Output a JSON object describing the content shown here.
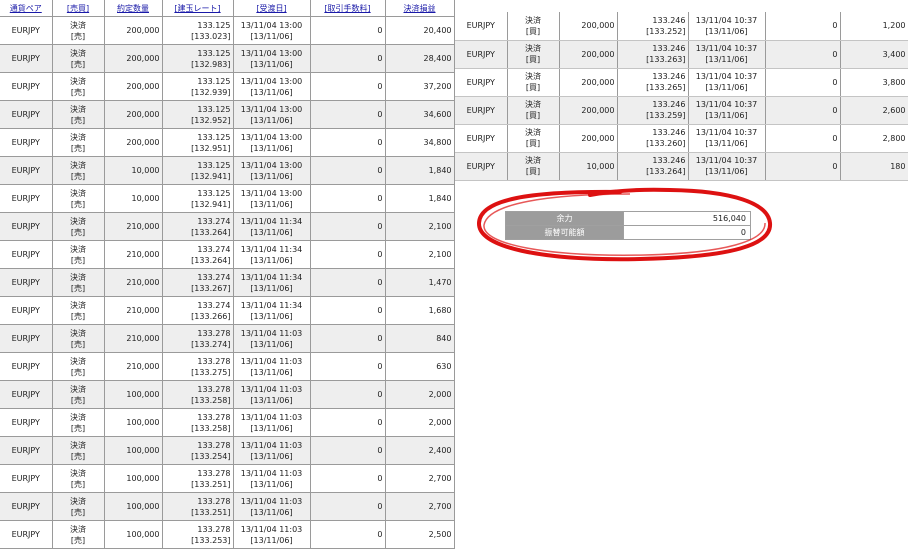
{
  "left_headers": [
    "通貨ペア",
    "[売買]",
    "約定数量",
    "[建玉レート]",
    "[受渡日]",
    "[取引手数料]",
    "決済損益"
  ],
  "left_rows": [
    {
      "pair": "EURJPY",
      "type": "決済",
      "side": "[売]",
      "qty": "200,000",
      "rate": "133.125",
      "open_rate": "[133.023]",
      "datetime": "13/11/04 13:00",
      "delivery": "[13/11/06]",
      "fee": "0",
      "pl": "20,400"
    },
    {
      "pair": "EURJPY",
      "type": "決済",
      "side": "[売]",
      "qty": "200,000",
      "rate": "133.125",
      "open_rate": "[132.983]",
      "datetime": "13/11/04 13:00",
      "delivery": "[13/11/06]",
      "fee": "0",
      "pl": "28,400"
    },
    {
      "pair": "EURJPY",
      "type": "決済",
      "side": "[売]",
      "qty": "200,000",
      "rate": "133.125",
      "open_rate": "[132.939]",
      "datetime": "13/11/04 13:00",
      "delivery": "[13/11/06]",
      "fee": "0",
      "pl": "37,200"
    },
    {
      "pair": "EURJPY",
      "type": "決済",
      "side": "[売]",
      "qty": "200,000",
      "rate": "133.125",
      "open_rate": "[132.952]",
      "datetime": "13/11/04 13:00",
      "delivery": "[13/11/06]",
      "fee": "0",
      "pl": "34,600"
    },
    {
      "pair": "EURJPY",
      "type": "決済",
      "side": "[売]",
      "qty": "200,000",
      "rate": "133.125",
      "open_rate": "[132.951]",
      "datetime": "13/11/04 13:00",
      "delivery": "[13/11/06]",
      "fee": "0",
      "pl": "34,800"
    },
    {
      "pair": "EURJPY",
      "type": "決済",
      "side": "[売]",
      "qty": "10,000",
      "rate": "133.125",
      "open_rate": "[132.941]",
      "datetime": "13/11/04 13:00",
      "delivery": "[13/11/06]",
      "fee": "0",
      "pl": "1,840"
    },
    {
      "pair": "EURJPY",
      "type": "決済",
      "side": "[売]",
      "qty": "10,000",
      "rate": "133.125",
      "open_rate": "[132.941]",
      "datetime": "13/11/04 13:00",
      "delivery": "[13/11/06]",
      "fee": "0",
      "pl": "1,840"
    },
    {
      "pair": "EURJPY",
      "type": "決済",
      "side": "[売]",
      "qty": "210,000",
      "rate": "133.274",
      "open_rate": "[133.264]",
      "datetime": "13/11/04 11:34",
      "delivery": "[13/11/06]",
      "fee": "0",
      "pl": "2,100"
    },
    {
      "pair": "EURJPY",
      "type": "決済",
      "side": "[売]",
      "qty": "210,000",
      "rate": "133.274",
      "open_rate": "[133.264]",
      "datetime": "13/11/04 11:34",
      "delivery": "[13/11/06]",
      "fee": "0",
      "pl": "2,100"
    },
    {
      "pair": "EURJPY",
      "type": "決済",
      "side": "[売]",
      "qty": "210,000",
      "rate": "133.274",
      "open_rate": "[133.267]",
      "datetime": "13/11/04 11:34",
      "delivery": "[13/11/06]",
      "fee": "0",
      "pl": "1,470"
    },
    {
      "pair": "EURJPY",
      "type": "決済",
      "side": "[売]",
      "qty": "210,000",
      "rate": "133.274",
      "open_rate": "[133.266]",
      "datetime": "13/11/04 11:34",
      "delivery": "[13/11/06]",
      "fee": "0",
      "pl": "1,680"
    },
    {
      "pair": "EURJPY",
      "type": "決済",
      "side": "[売]",
      "qty": "210,000",
      "rate": "133.278",
      "open_rate": "[133.274]",
      "datetime": "13/11/04 11:03",
      "delivery": "[13/11/06]",
      "fee": "0",
      "pl": "840"
    },
    {
      "pair": "EURJPY",
      "type": "決済",
      "side": "[売]",
      "qty": "210,000",
      "rate": "133.278",
      "open_rate": "[133.275]",
      "datetime": "13/11/04 11:03",
      "delivery": "[13/11/06]",
      "fee": "0",
      "pl": "630"
    },
    {
      "pair": "EURJPY",
      "type": "決済",
      "side": "[売]",
      "qty": "100,000",
      "rate": "133.278",
      "open_rate": "[133.258]",
      "datetime": "13/11/04 11:03",
      "delivery": "[13/11/06]",
      "fee": "0",
      "pl": "2,000"
    },
    {
      "pair": "EURJPY",
      "type": "決済",
      "side": "[売]",
      "qty": "100,000",
      "rate": "133.278",
      "open_rate": "[133.258]",
      "datetime": "13/11/04 11:03",
      "delivery": "[13/11/06]",
      "fee": "0",
      "pl": "2,000"
    },
    {
      "pair": "EURJPY",
      "type": "決済",
      "side": "[売]",
      "qty": "100,000",
      "rate": "133.278",
      "open_rate": "[133.254]",
      "datetime": "13/11/04 11:03",
      "delivery": "[13/11/06]",
      "fee": "0",
      "pl": "2,400"
    },
    {
      "pair": "EURJPY",
      "type": "決済",
      "side": "[売]",
      "qty": "100,000",
      "rate": "133.278",
      "open_rate": "[133.251]",
      "datetime": "13/11/04 11:03",
      "delivery": "[13/11/06]",
      "fee": "0",
      "pl": "2,700"
    },
    {
      "pair": "EURJPY",
      "type": "決済",
      "side": "[売]",
      "qty": "100,000",
      "rate": "133.278",
      "open_rate": "[133.251]",
      "datetime": "13/11/04 11:03",
      "delivery": "[13/11/06]",
      "fee": "0",
      "pl": "2,700"
    },
    {
      "pair": "EURJPY",
      "type": "決済",
      "side": "[売]",
      "qty": "100,000",
      "rate": "133.278",
      "open_rate": "[133.253]",
      "datetime": "13/11/04 11:03",
      "delivery": "[13/11/06]",
      "fee": "0",
      "pl": "2,500"
    }
  ],
  "right_rows": [
    {
      "pair": "EURJPY",
      "type": "決済",
      "side": "[買]",
      "qty": "200,000",
      "rate": "133.246",
      "open_rate": "[133.252]",
      "datetime": "13/11/04 10:37",
      "delivery": "[13/11/06]",
      "fee": "0",
      "pl": "1,200"
    },
    {
      "pair": "EURJPY",
      "type": "決済",
      "side": "[買]",
      "qty": "200,000",
      "rate": "133.246",
      "open_rate": "[133.263]",
      "datetime": "13/11/04 10:37",
      "delivery": "[13/11/06]",
      "fee": "0",
      "pl": "3,400"
    },
    {
      "pair": "EURJPY",
      "type": "決済",
      "side": "[買]",
      "qty": "200,000",
      "rate": "133.246",
      "open_rate": "[133.265]",
      "datetime": "13/11/04 10:37",
      "delivery": "[13/11/06]",
      "fee": "0",
      "pl": "3,800"
    },
    {
      "pair": "EURJPY",
      "type": "決済",
      "side": "[買]",
      "qty": "200,000",
      "rate": "133.246",
      "open_rate": "[133.259]",
      "datetime": "13/11/04 10:37",
      "delivery": "[13/11/06]",
      "fee": "0",
      "pl": "2,600"
    },
    {
      "pair": "EURJPY",
      "type": "決済",
      "side": "[買]",
      "qty": "200,000",
      "rate": "133.246",
      "open_rate": "[133.260]",
      "datetime": "13/11/04 10:37",
      "delivery": "[13/11/06]",
      "fee": "0",
      "pl": "2,800"
    },
    {
      "pair": "EURJPY",
      "type": "決済",
      "side": "[買]",
      "qty": "10,000",
      "rate": "133.246",
      "open_rate": "[133.264]",
      "datetime": "13/11/04 10:37",
      "delivery": "[13/11/06]",
      "fee": "0",
      "pl": "180"
    }
  ],
  "summary": {
    "margin_label": "余力",
    "margin_value": "516,040",
    "transfer_label": "振替可能額",
    "transfer_value": "0"
  },
  "colors": {
    "highlight_circle": "#dd1111",
    "row_alt": "#eeeeee",
    "header_link": "#1a1aa8"
  }
}
